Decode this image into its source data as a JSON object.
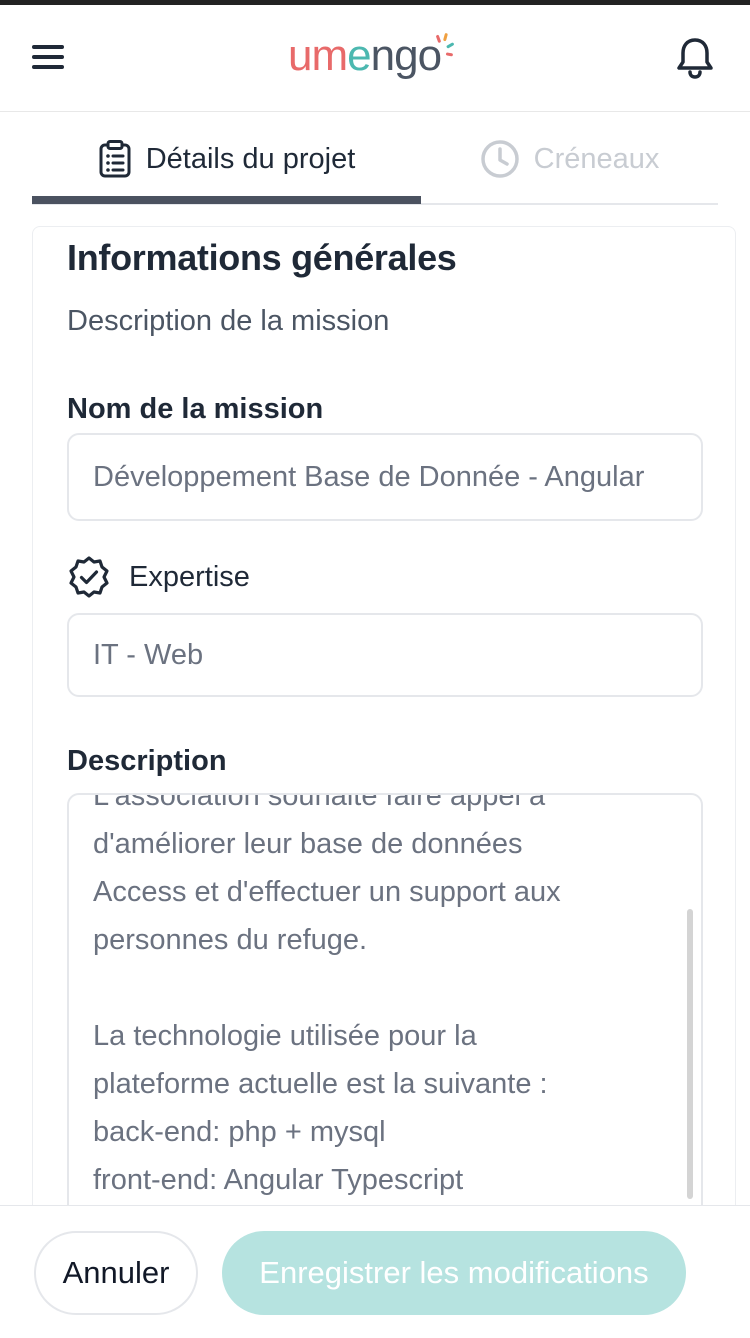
{
  "header": {
    "logo_text": "umengo",
    "menu_icon": "hamburger-menu-icon",
    "bell_icon": "bell-icon",
    "brand_colors": {
      "coral": "#e86a6a",
      "teal": "#4cb8b0",
      "gray": "#4b5563"
    }
  },
  "tabs": [
    {
      "label": "Détails du projet",
      "icon": "clipboard-list-icon",
      "active": true
    },
    {
      "label": "Créneaux",
      "icon": "clock-icon",
      "active": false
    }
  ],
  "section": {
    "title": "Informations générales",
    "subtitle": "Description de la mission"
  },
  "form": {
    "mission_name_label": "Nom de la mission",
    "mission_name_value": "Développement Base de Donnée - Angular",
    "expertise_label": "Expertise",
    "expertise_icon": "check-badge-icon",
    "expertise_value": "IT - Web",
    "description_label": "Description",
    "description_lines": [
      "L'association souhaite faire appel à",
      "d'améliorer leur base de données",
      "Access et d'effectuer un support aux",
      "personnes du refuge.",
      "",
      "La technologie utilisée pour la",
      "plateforme actuelle est la suivante :",
      "back-end: php + mysql",
      "front-end: Angular Typescript"
    ]
  },
  "footer": {
    "cancel_label": "Annuler",
    "save_label": "Enregistrer les modifications",
    "save_color": "#b6e3e0"
  }
}
